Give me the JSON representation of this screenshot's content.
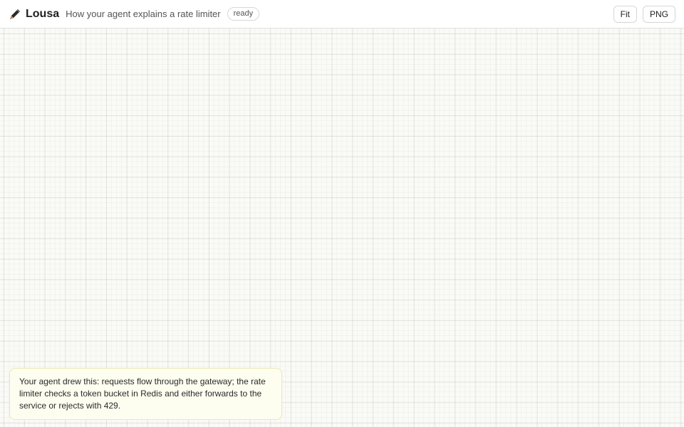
{
  "header": {
    "brand_icon": "pen-icon",
    "brand_name": "Lousa",
    "title": "How your agent explains a rate limiter",
    "status": "ready",
    "fit_label": "Fit",
    "png_label": "PNG"
  },
  "caption": {
    "text": "Your agent drew this: requests flow through the gateway; the rate limiter checks a token bucket in Redis and either forwards to the service or rejects with 429."
  }
}
